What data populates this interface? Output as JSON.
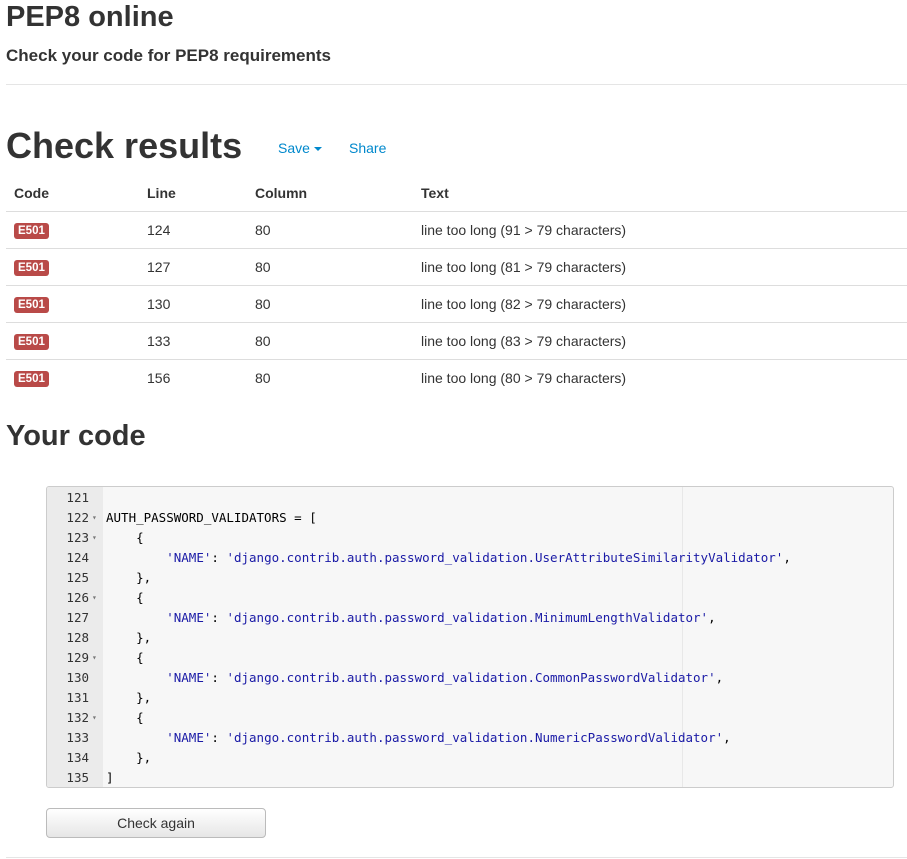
{
  "header": {
    "title": "PEP8 online",
    "subtitle": "Check your code for PEP8 requirements"
  },
  "results": {
    "heading": "Check results",
    "save_label": "Save",
    "share_label": "Share",
    "columns": [
      "Code",
      "Line",
      "Column",
      "Text"
    ],
    "rows": [
      {
        "code": "E501",
        "line": "124",
        "column": "80",
        "text": "line too long (91 > 79 characters)"
      },
      {
        "code": "E501",
        "line": "127",
        "column": "80",
        "text": "line too long (81 > 79 characters)"
      },
      {
        "code": "E501",
        "line": "130",
        "column": "80",
        "text": "line too long (82 > 79 characters)"
      },
      {
        "code": "E501",
        "line": "133",
        "column": "80",
        "text": "line too long (83 > 79 characters)"
      },
      {
        "code": "E501",
        "line": "156",
        "column": "80",
        "text": "line too long (80 > 79 characters)"
      }
    ],
    "badge_color": "#b94a48"
  },
  "code_section": {
    "heading": "Your code",
    "lines": [
      {
        "n": "121",
        "fold": false,
        "indent": "",
        "pre": "",
        "str": "",
        "post": ""
      },
      {
        "n": "122",
        "fold": true,
        "indent": "",
        "pre": "AUTH_PASSWORD_VALIDATORS = [",
        "str": "",
        "post": ""
      },
      {
        "n": "123",
        "fold": true,
        "indent": "    ",
        "pre": "{",
        "str": "",
        "post": ""
      },
      {
        "n": "124",
        "fold": false,
        "indent": "        ",
        "pre": "",
        "str": "'NAME'",
        "post": ": ",
        "str2": "'django.contrib.auth.password_validation.UserAttributeSimilarityValidator'",
        "post2": ","
      },
      {
        "n": "125",
        "fold": false,
        "indent": "    ",
        "pre": "},",
        "str": "",
        "post": ""
      },
      {
        "n": "126",
        "fold": true,
        "indent": "    ",
        "pre": "{",
        "str": "",
        "post": ""
      },
      {
        "n": "127",
        "fold": false,
        "indent": "        ",
        "pre": "",
        "str": "'NAME'",
        "post": ": ",
        "str2": "'django.contrib.auth.password_validation.MinimumLengthValidator'",
        "post2": ","
      },
      {
        "n": "128",
        "fold": false,
        "indent": "    ",
        "pre": "},",
        "str": "",
        "post": ""
      },
      {
        "n": "129",
        "fold": true,
        "indent": "    ",
        "pre": "{",
        "str": "",
        "post": ""
      },
      {
        "n": "130",
        "fold": false,
        "indent": "        ",
        "pre": "",
        "str": "'NAME'",
        "post": ": ",
        "str2": "'django.contrib.auth.password_validation.CommonPasswordValidator'",
        "post2": ","
      },
      {
        "n": "131",
        "fold": false,
        "indent": "    ",
        "pre": "},",
        "str": "",
        "post": ""
      },
      {
        "n": "132",
        "fold": true,
        "indent": "    ",
        "pre": "{",
        "str": "",
        "post": ""
      },
      {
        "n": "133",
        "fold": false,
        "indent": "        ",
        "pre": "",
        "str": "'NAME'",
        "post": ": ",
        "str2": "'django.contrib.auth.password_validation.NumericPasswordValidator'",
        "post2": ","
      },
      {
        "n": "134",
        "fold": false,
        "indent": "    ",
        "pre": "},",
        "str": "",
        "post": ""
      },
      {
        "n": "135",
        "fold": false,
        "indent": "",
        "pre": "]",
        "str": "",
        "post": ""
      }
    ],
    "check_again_label": "Check again"
  },
  "colors": {
    "link": "#0088cc",
    "string": "#1a1aa6",
    "text": "#333333"
  },
  "icons": {
    "save_dropdown": "caret-down-icon",
    "fold_marker": "fold-arrow-icon"
  }
}
